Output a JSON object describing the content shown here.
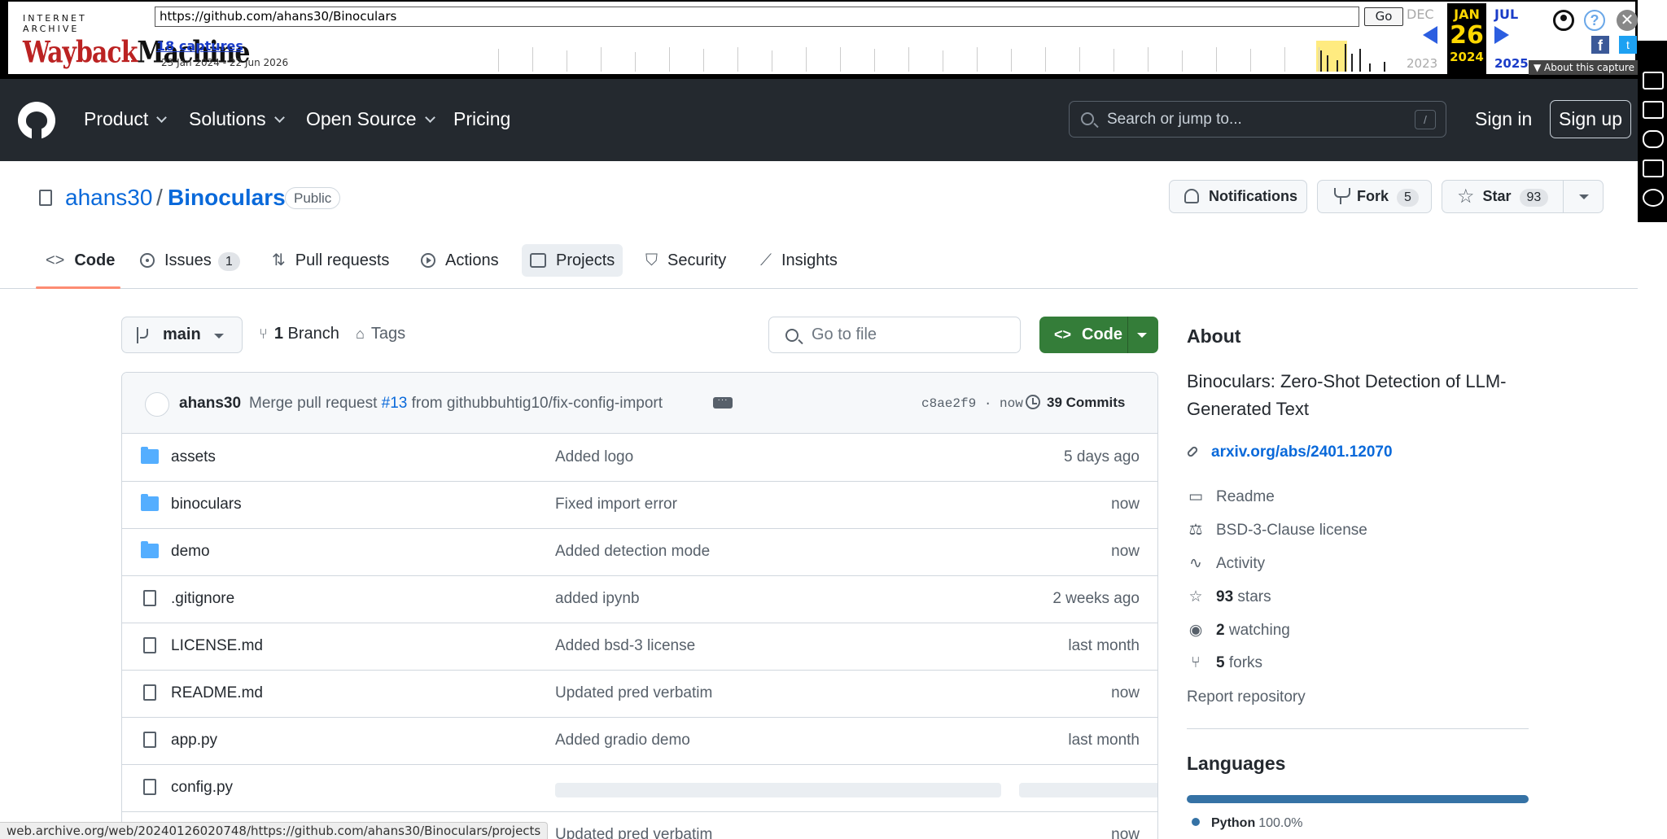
{
  "wayback": {
    "logo_top": "INTERNET ARCHIVE",
    "logo_main_a": "Wayback",
    "logo_main_b": "Machine",
    "url": "https://github.com/ahans30/Binoculars",
    "go_label": "Go",
    "captures": "18 captures",
    "range": "23 Jan 2024 - 22 Jun 2026",
    "prev_month": "DEC",
    "prev_year": "2023",
    "cur_month": "JAN",
    "cur_day": "26",
    "cur_year": "2024",
    "next_month": "JUL",
    "next_year": "2025",
    "about_label": "About this capture",
    "help_label": "?",
    "close_label": "✕",
    "fb_label": "f",
    "tw_label": "t"
  },
  "header": {
    "nav": [
      {
        "label": "Product",
        "dropdown": true
      },
      {
        "label": "Solutions",
        "dropdown": true
      },
      {
        "label": "Open Source",
        "dropdown": true
      },
      {
        "label": "Pricing",
        "dropdown": false
      }
    ],
    "search_placeholder": "Search or jump to...",
    "search_key": "/",
    "sign_in": "Sign in",
    "sign_up": "Sign up"
  },
  "repo": {
    "owner": "ahans30",
    "separator": "/",
    "name": "Binoculars",
    "visibility": "Public",
    "notifications_label": "Notifications",
    "fork_label": "Fork",
    "fork_count": "5",
    "star_label": "Star",
    "star_count": "93"
  },
  "tabs": [
    {
      "label": "Code",
      "count": null,
      "icon": "code-icon"
    },
    {
      "label": "Issues",
      "count": "1",
      "icon": "issue-icon"
    },
    {
      "label": "Pull requests",
      "count": null,
      "icon": "pull-request-icon"
    },
    {
      "label": "Actions",
      "count": null,
      "icon": "actions-icon"
    },
    {
      "label": "Projects",
      "count": null,
      "icon": "projects-icon"
    },
    {
      "label": "Security",
      "count": null,
      "icon": "shield-icon"
    },
    {
      "label": "Insights",
      "count": null,
      "icon": "graph-icon"
    }
  ],
  "toolbar": {
    "branch": "main",
    "branch_count": "1",
    "branch_label": "Branch",
    "tags_label": "Tags",
    "go_to_file": "Go to file",
    "code_button": "Code"
  },
  "commit": {
    "author": "ahans30",
    "msg_prefix": "Merge pull request ",
    "pr": "#13",
    "msg_suffix": " from githubbuhtig10/fix-config-import",
    "sha_time": "c8ae2f9 · now",
    "count_label": "39 Commits"
  },
  "files": [
    {
      "name": "assets",
      "type": "dir",
      "message": "Added logo",
      "date": "5 days ago"
    },
    {
      "name": "binoculars",
      "type": "dir",
      "message": "Fixed import error",
      "date": "now"
    },
    {
      "name": "demo",
      "type": "dir",
      "message": "Added detection mode",
      "date": "now"
    },
    {
      "name": ".gitignore",
      "type": "file",
      "message": "added ipynb",
      "date": "2 weeks ago"
    },
    {
      "name": "LICENSE.md",
      "type": "file",
      "message": "Added bsd-3 license",
      "date": "last month"
    },
    {
      "name": "README.md",
      "type": "file",
      "message": "Updated pred verbatim",
      "date": "now"
    },
    {
      "name": "app.py",
      "type": "file",
      "message": "Added gradio demo",
      "date": "last month"
    },
    {
      "name": "config.py",
      "type": "file",
      "message": "",
      "date": ""
    },
    {
      "name": "",
      "type": "file",
      "message": "Updated pred verbatim",
      "date": "now"
    }
  ],
  "about": {
    "heading": "About",
    "description": "Binoculars: Zero-Shot Detection of LLM-Generated Text",
    "link": "arxiv.org/abs/2401.12070",
    "items": [
      {
        "icon": "book-icon",
        "bold": "",
        "text": "Readme"
      },
      {
        "icon": "law-icon",
        "bold": "",
        "text": "BSD-3-Clause license"
      },
      {
        "icon": "pulse-icon",
        "bold": "",
        "text": "Activity"
      },
      {
        "icon": "star-icon",
        "bold": "93",
        "text": " stars"
      },
      {
        "icon": "eye-icon",
        "bold": "2",
        "text": " watching"
      },
      {
        "icon": "fork-icon",
        "bold": "5",
        "text": " forks"
      }
    ],
    "report": "Report repository",
    "languages_heading": "Languages",
    "languages": [
      {
        "name": "Python",
        "percent": "100.0%",
        "color": "#3572a5"
      }
    ]
  },
  "status_url": "web.archive.org/web/20240126020748/https://github.com/ahans30/Binoculars/projects"
}
